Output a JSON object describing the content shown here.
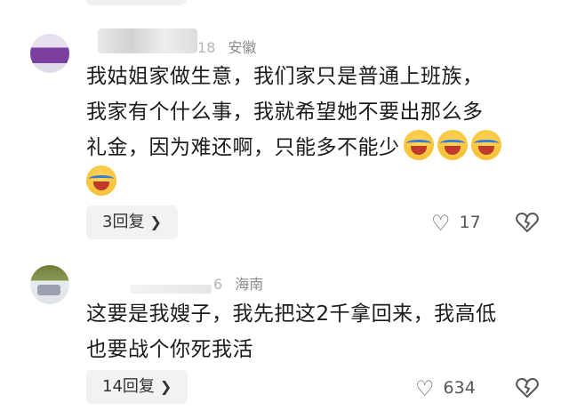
{
  "comments": [
    {
      "name_suffix": "18",
      "location": "安徽",
      "text_lines": [
        "我姑姐家做生意，我们家只是普通上班族，",
        "我家有个什么事，我就希望她不要出那么多",
        "礼金，因为难还啊，只能多不能少"
      ],
      "emoji_name": "crying-laughing-emoji",
      "reply_label": "3回复",
      "like_count": "17"
    },
    {
      "name_suffix": "6",
      "location": "海南",
      "text_lines": [
        "这要是我嫂子，我先把这2千拿回来，我高低",
        "也要战个你死我活"
      ],
      "reply_label": "14回复",
      "like_count": "634"
    }
  ],
  "icons": {
    "like": "heart-outline-icon",
    "dislike": "broken-heart-icon",
    "chevron": "chevron-right-icon"
  },
  "colors": {
    "text": "#1b1b1b",
    "meta": "#8a8a8a",
    "button_bg": "#f2f2f2"
  }
}
